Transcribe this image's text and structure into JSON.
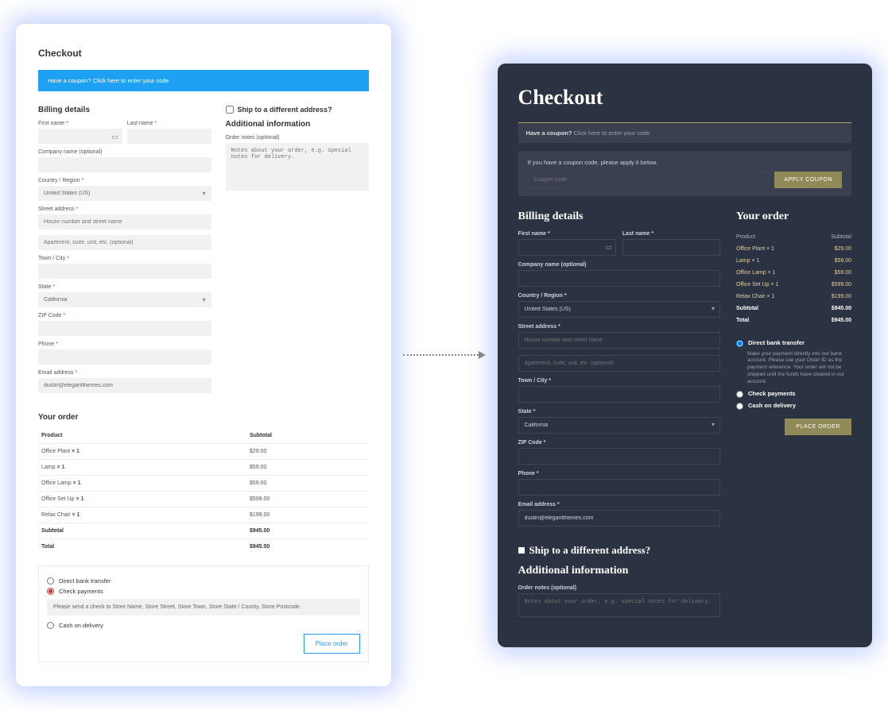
{
  "title": "Checkout",
  "coupon_bar": "Have a coupon? Click here to enter your code",
  "billing_heading": "Billing details",
  "labels": {
    "first_name": "First name",
    "last_name": "Last name",
    "company": "Company name (optional)",
    "country": "Country / Region",
    "street": "Street address",
    "town": "Town / City",
    "state": "State",
    "zip": "ZIP Code",
    "phone": "Phone",
    "email": "Email address"
  },
  "placeholders": {
    "street1": "House number and street name",
    "street2": "Apartment, suite, unit, etc. (optional)",
    "order_notes": "Notes about your order, e.g. special notes for delivery."
  },
  "country_value": "United States (US)",
  "state_value": "California",
  "email_value": "dustin@elegantthemes.com",
  "ship_heading": "Ship to a different address?",
  "addl_heading": "Additional information",
  "notes_label": "Order notes (optional)",
  "order_heading": "Your order",
  "order_cols": {
    "product": "Product",
    "subtotal": "Subtotal"
  },
  "order_items": [
    {
      "name": "Office Plant",
      "qty": "× 1",
      "price": "$29.00"
    },
    {
      "name": "Lamp",
      "qty": "× 1",
      "price": "$59.00"
    },
    {
      "name": "Office Lamp",
      "qty": "× 1",
      "price": "$59.00"
    },
    {
      "name": "Office Set Up",
      "qty": "× 1",
      "price": "$599.00"
    },
    {
      "name": "Relax Chair",
      "qty": "× 1",
      "price": "$199.00"
    }
  ],
  "subtotal_label": "Subtotal",
  "subtotal": "$945.00",
  "total_label": "Total",
  "total": "$945.00",
  "pay": {
    "bank": "Direct bank transfer",
    "check": "Check payments",
    "check_note": "Please send a check to Store Name, Store Street, Store Town, Store State / County, Store Postcode.",
    "cash": "Cash on delivery"
  },
  "place_order": "Place order",
  "dark": {
    "coupon_prompt_strong": "Have a coupon?",
    "coupon_prompt_rest": "Click here to enter your code",
    "coupon_form_note": "If you have a coupon code, please apply it below.",
    "coupon_placeholder": "Coupon code",
    "apply": "APPLY COUPON",
    "bank_desc": "Make your payment directly into our bank account. Please use your Order ID as the payment reference. Your order will not be shipped until the funds have cleared in our account.",
    "place_order": "PLACE ORDER"
  }
}
